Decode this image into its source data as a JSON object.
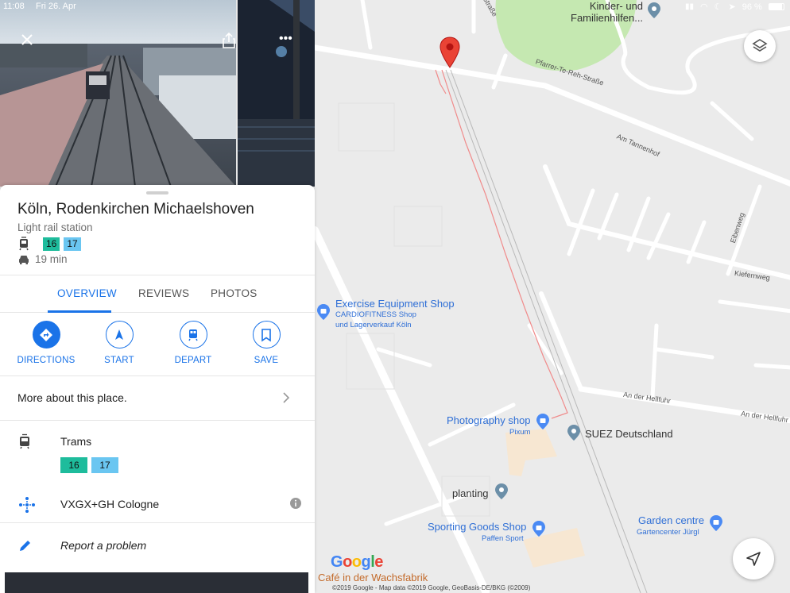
{
  "status_bar": {
    "time": "11:08",
    "date": "Fri 26. Apr",
    "battery": "96 %"
  },
  "place": {
    "title": "Köln, Rodenkirchen Michaelshoven",
    "type": "Light rail station",
    "lines": [
      "16",
      "17"
    ],
    "drive_time": "19 min"
  },
  "tabs": [
    {
      "label": "OVERVIEW",
      "active": true
    },
    {
      "label": "REVIEWS",
      "active": false
    },
    {
      "label": "PHOTOS",
      "active": false
    }
  ],
  "actions": [
    {
      "label": "DIRECTIONS",
      "icon": "directions-icon"
    },
    {
      "label": "START",
      "icon": "navigation-arrow-icon"
    },
    {
      "label": "DEPART",
      "icon": "train-icon"
    },
    {
      "label": "SAVE",
      "icon": "bookmark-icon"
    }
  ],
  "more_about": "More about this place.",
  "trams": {
    "label": "Trams",
    "lines": [
      "16",
      "17"
    ]
  },
  "plus_code": "VXGX+GH Cologne",
  "report": "Report a problem",
  "colors": {
    "accent": "#1a73e8",
    "line16": "#1ebc9c",
    "line17": "#6ac6f1",
    "pin": "#ea4335",
    "park": "#c5e8b1"
  },
  "map": {
    "streets": {
      "str_top": "-Straße",
      "pfarrer": "Pfarrer-Te-Reh-Straße",
      "tannenhof": "Am Tannenhof",
      "eibenweg": "Eibenweg",
      "kiefernweg": "Kiefernweg",
      "hellfuhr1": "An der Hellfuhr",
      "hellfuhr2": "An der Hellfuhr"
    },
    "pois": {
      "kinder": "Kinder- und\nFamilienhilfen...",
      "exercise": "Exercise Equipment Shop",
      "exercise_sub1": "CARDIOFITNESS Shop",
      "exercise_sub2": "und Lagerverkauf Köln",
      "photo": "Photography shop",
      "photo_sub": "Pixum",
      "suez": "SUEZ Deutschland",
      "planting": "planting",
      "sporting": "Sporting Goods Shop",
      "sporting_sub": "Paffen Sport",
      "garden": "Garden centre",
      "garden_sub": "Gartencenter Jürgl",
      "cafe": "Café in der Wachsfabrik"
    },
    "google": "Google",
    "attribution": "©2019 Google - Map data ©2019 Google, GeoBasis-DE/BKG (©2009)"
  }
}
